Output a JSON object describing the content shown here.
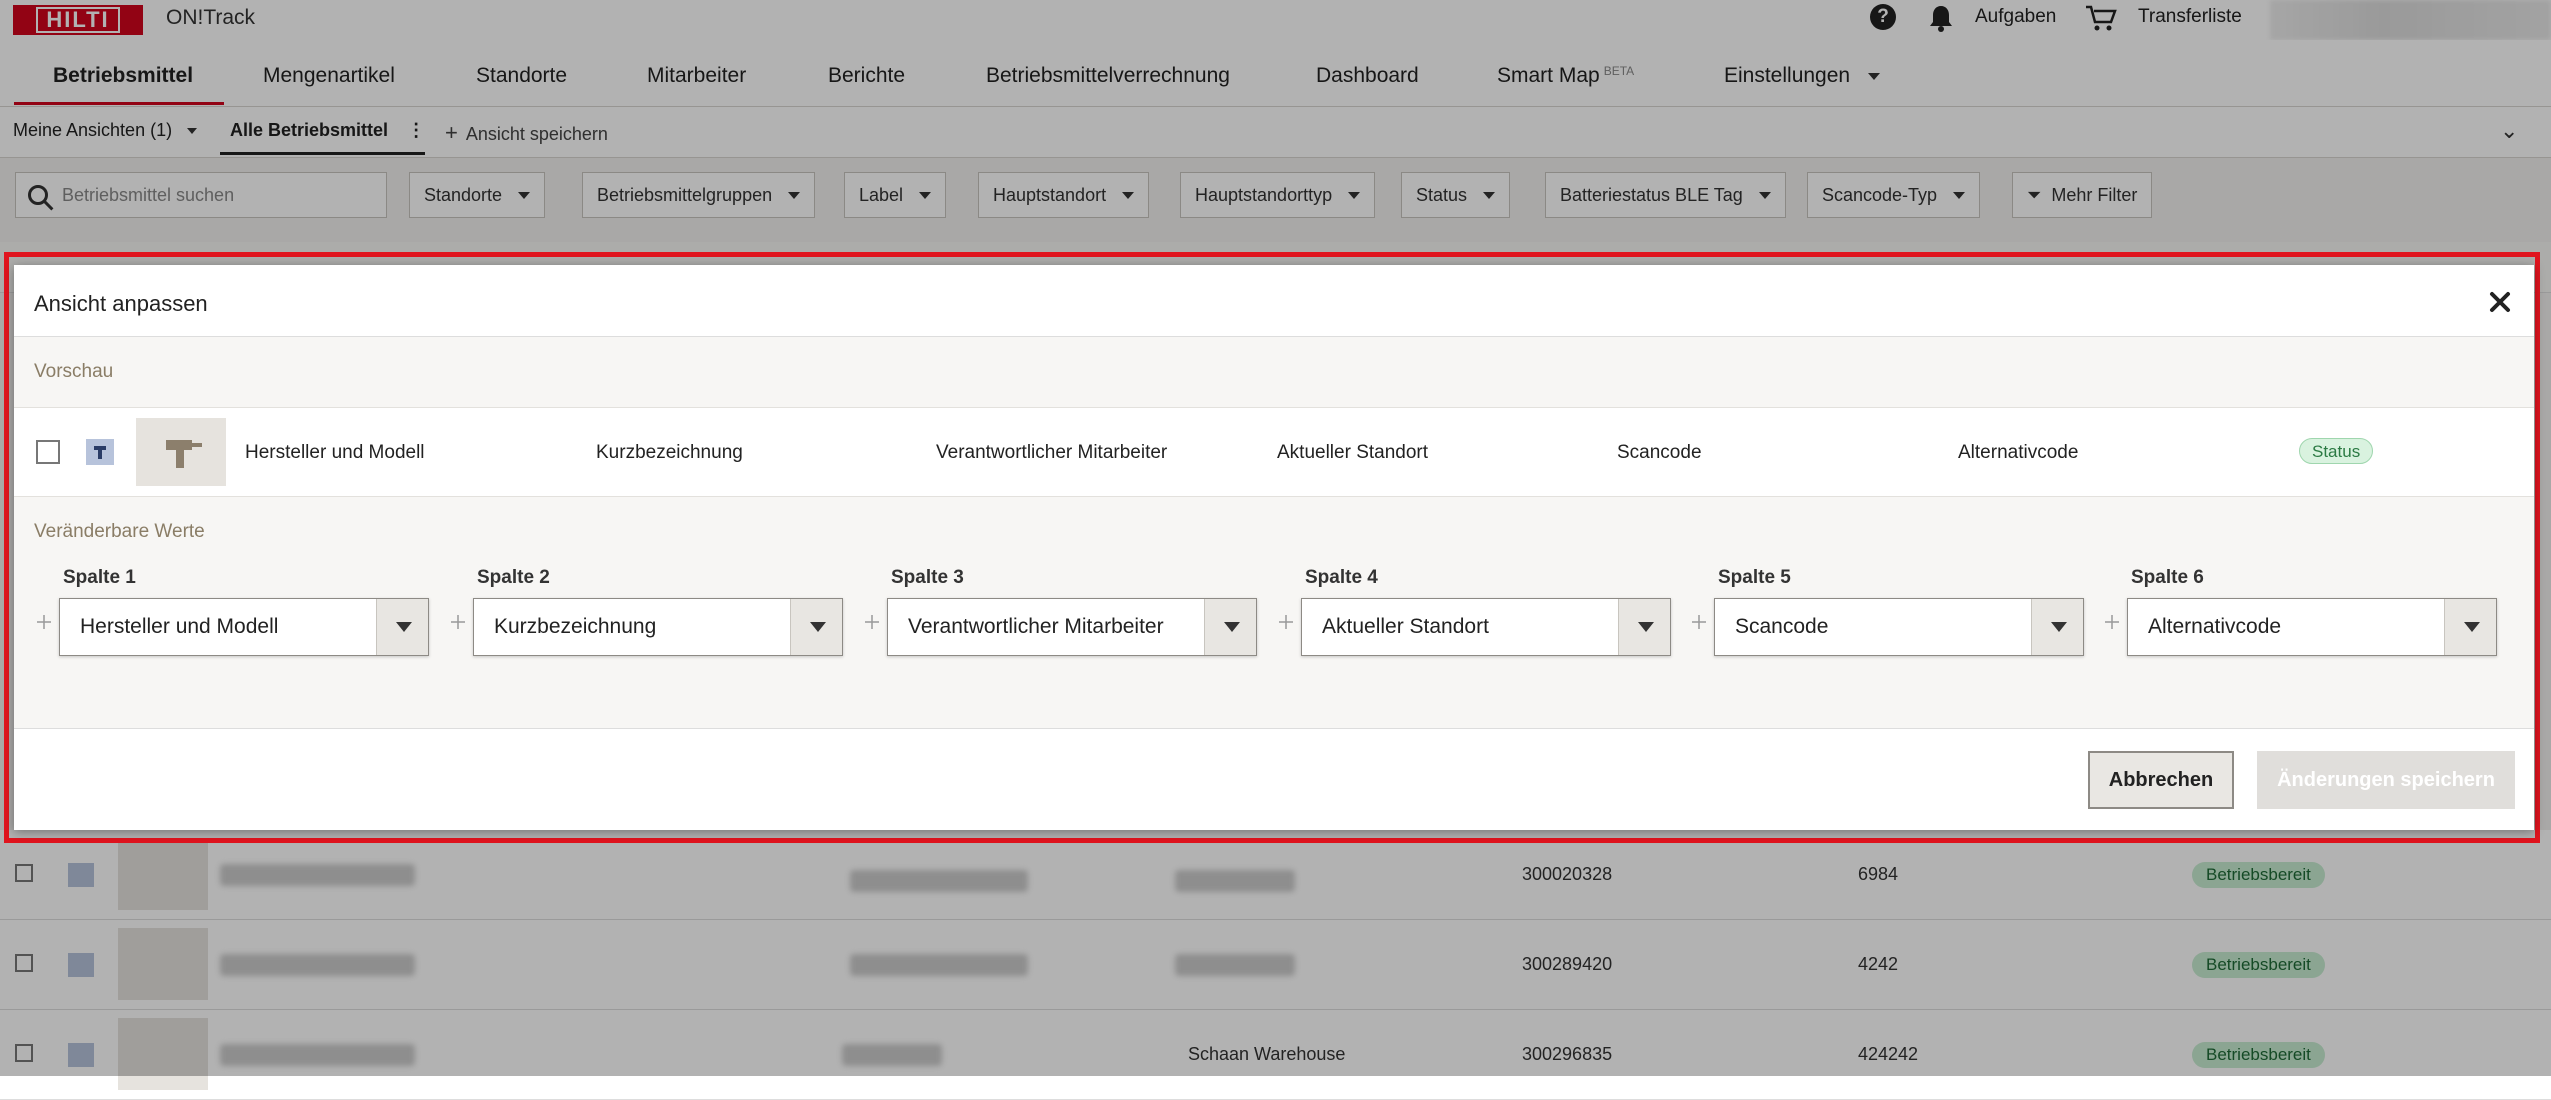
{
  "header": {
    "logo_text": "HILTI",
    "app_title": "ON!Track",
    "aufgaben_label": "Aufgaben",
    "transferliste_label": "Transferliste"
  },
  "nav": {
    "items": [
      "Betriebsmittel",
      "Mengenartikel",
      "Standorte",
      "Mitarbeiter",
      "Berichte",
      "Betriebsmittelverrechnung",
      "Dashboard",
      "Smart Map",
      "Einstellungen"
    ],
    "smartmap_badge": "BETA"
  },
  "subnav": {
    "my_views": "Meine Ansichten (1)",
    "all_assets": "Alle Betriebsmittel",
    "save_view": "Ansicht speichern"
  },
  "filters": {
    "search_placeholder": "Betriebsmittel suchen",
    "items": [
      "Standorte",
      "Betriebsmittelgruppen",
      "Label",
      "Hauptstandort",
      "Hauptstandorttyp",
      "Status",
      "Batteriestatus BLE Tag",
      "Scancode-Typ"
    ],
    "more": "Mehr Filter"
  },
  "table": {
    "rows": [
      {
        "location": "",
        "scancode": "300020328",
        "altcode": "6984",
        "status": "Betriebsbereit"
      },
      {
        "location": "",
        "scancode": "300289420",
        "altcode": "4242",
        "status": "Betriebsbereit"
      },
      {
        "location": "Schaan Warehouse",
        "scancode": "300296835",
        "altcode": "424242",
        "status": "Betriebsbereit"
      }
    ]
  },
  "modal": {
    "title": "Ansicht anpassen",
    "preview_label": "Vorschau",
    "preview_columns": [
      "Hersteller und Modell",
      "Kurzbezeichnung",
      "Verantwortlicher Mitarbeiter",
      "Aktueller Standort",
      "Scancode",
      "Alternativcode"
    ],
    "preview_status": "Status",
    "editable_label": "Veränderbare Werte",
    "columns": [
      {
        "label": "Spalte 1",
        "value": "Hersteller und Modell"
      },
      {
        "label": "Spalte 2",
        "value": "Kurzbezeichnung"
      },
      {
        "label": "Spalte 3",
        "value": "Verantwortlicher Mitarbeiter"
      },
      {
        "label": "Spalte 4",
        "value": "Aktueller Standort"
      },
      {
        "label": "Spalte 5",
        "value": "Scancode"
      },
      {
        "label": "Spalte 6",
        "value": "Alternativcode"
      }
    ],
    "cancel_label": "Abbrechen",
    "save_label": "Änderungen speichern"
  },
  "colors": {
    "brand_red": "#d2051e",
    "status_green_bg": "#c7ecd1",
    "status_green_text": "#1f6b37",
    "highlight_frame": "#e0141e"
  }
}
